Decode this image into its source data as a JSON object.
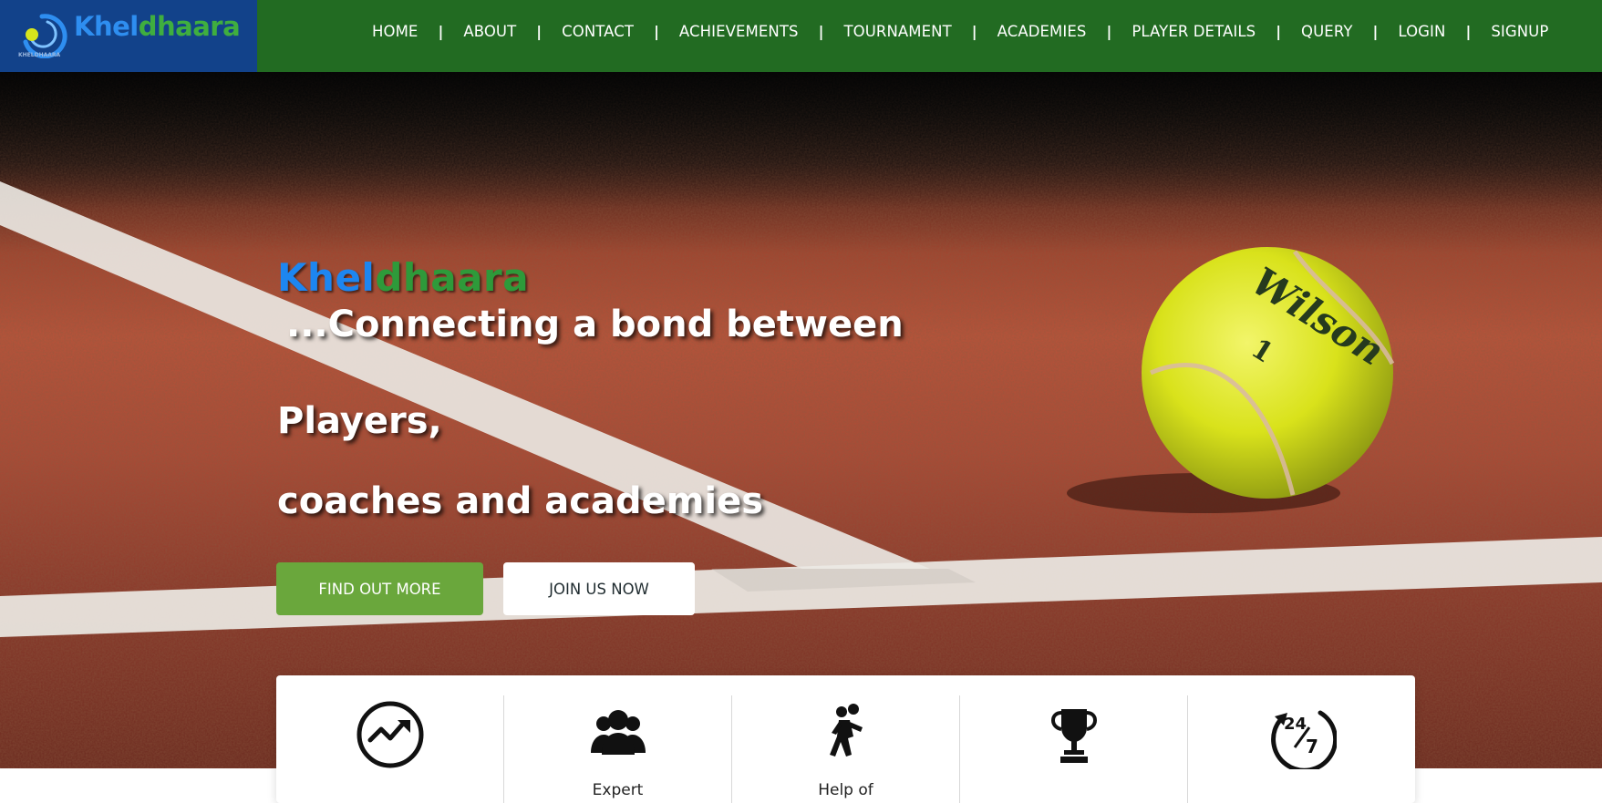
{
  "brand": {
    "name_part1": "Khel",
    "name_part2": "dhaara",
    "logo_text": "KHELDHAARA",
    "colors": {
      "blue": "#2e8ef0",
      "green": "#3fae3f"
    }
  },
  "nav": {
    "items": [
      {
        "label": "HOME"
      },
      {
        "label": "ABOUT"
      },
      {
        "label": "CONTACT"
      },
      {
        "label": "ACHIEVEMENTS"
      },
      {
        "label": "TOURNAMENT"
      },
      {
        "label": "ACADEMIES"
      },
      {
        "label": "PLAYER DETAILS"
      },
      {
        "label": "QUERY"
      },
      {
        "label": "LOGIN"
      },
      {
        "label": "SIGNUP"
      }
    ],
    "separator": "|",
    "background": "#226b22"
  },
  "hero": {
    "title_part1": "Khel",
    "title_part2": "dhaara",
    "tagline": "...Connecting a bond between",
    "line1": "Players,",
    "line2": "coaches and academies",
    "primary_button": "FIND OUT MORE",
    "secondary_button": "JOIN US NOW",
    "ball_text": "Wilson",
    "ball_number": "1",
    "accent_color": "#6aa73c"
  },
  "features": [
    {
      "icon": "growth-chart-icon",
      "label": ""
    },
    {
      "icon": "users-group-icon",
      "label": "Expert"
    },
    {
      "icon": "player-running-icon",
      "label": "Help of"
    },
    {
      "icon": "trophy-icon",
      "label": ""
    },
    {
      "icon": "24-7-icon",
      "label": ""
    }
  ]
}
